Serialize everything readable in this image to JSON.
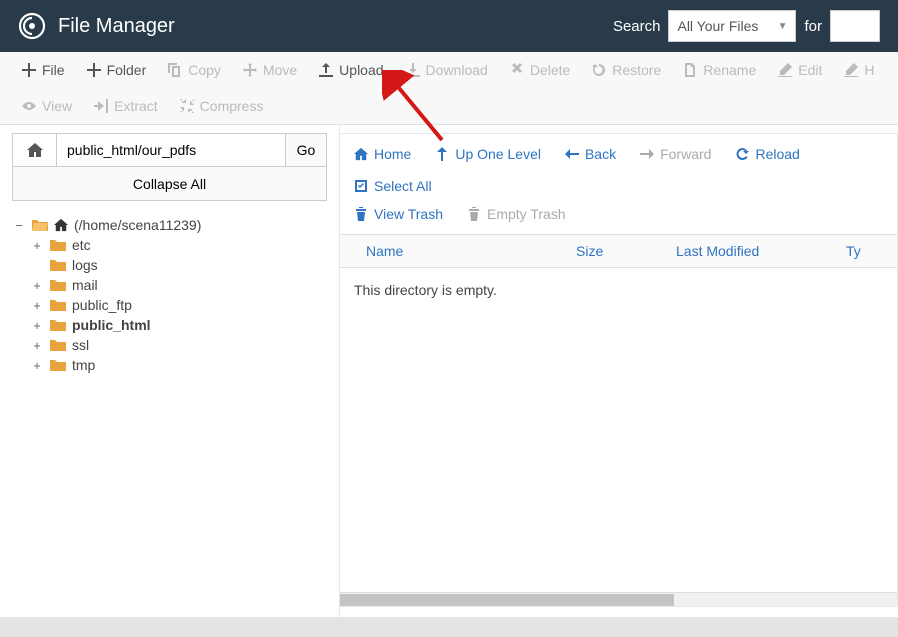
{
  "header": {
    "title": "File Manager",
    "search_label": "Search",
    "search_select": "All Your Files",
    "search_for": "for"
  },
  "toolbar": {
    "file": "File",
    "folder": "Folder",
    "copy": "Copy",
    "move": "Move",
    "upload": "Upload",
    "download": "Download",
    "delete": "Delete",
    "restore": "Restore",
    "rename": "Rename",
    "edit": "Edit",
    "html_editor": "H",
    "view": "View",
    "extract": "Extract",
    "compress": "Compress"
  },
  "sidebar": {
    "path_value": "public_html/our_pdfs",
    "go": "Go",
    "collapse_all": "Collapse All",
    "root_label": "(/home/scena11239)",
    "items": [
      {
        "label": "etc",
        "expandable": true,
        "bold": false
      },
      {
        "label": "logs",
        "expandable": false,
        "bold": false
      },
      {
        "label": "mail",
        "expandable": true,
        "bold": false
      },
      {
        "label": "public_ftp",
        "expandable": true,
        "bold": false
      },
      {
        "label": "public_html",
        "expandable": true,
        "bold": true
      },
      {
        "label": "ssl",
        "expandable": true,
        "bold": false
      },
      {
        "label": "tmp",
        "expandable": true,
        "bold": false
      }
    ]
  },
  "content_nav": {
    "home": "Home",
    "up_one": "Up One Level",
    "back": "Back",
    "forward": "Forward",
    "reload": "Reload",
    "select_all": "Select All",
    "view_trash": "View Trash",
    "empty_trash": "Empty Trash"
  },
  "table": {
    "headers": {
      "name": "Name",
      "size": "Size",
      "last_modified": "Last Modified",
      "type": "Ty"
    },
    "empty_message": "This directory is empty."
  }
}
